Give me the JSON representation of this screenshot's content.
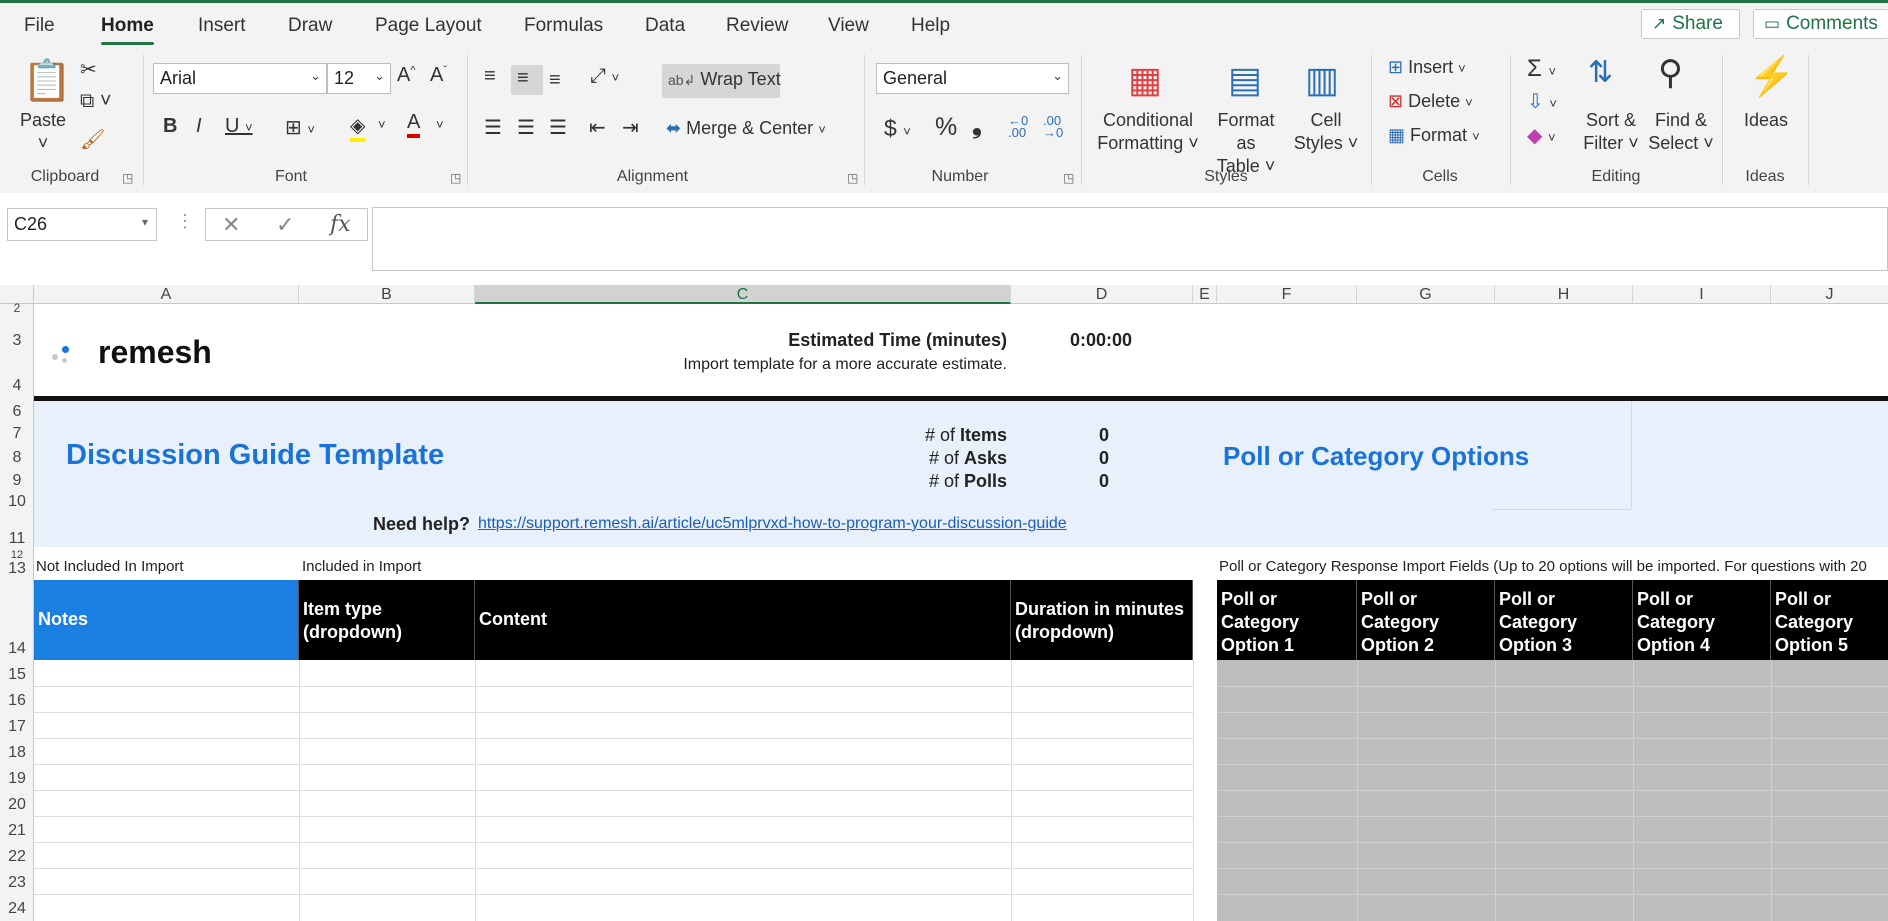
{
  "ribbon_tabs": [
    "File",
    "Home",
    "Insert",
    "Draw",
    "Page Layout",
    "Formulas",
    "Data",
    "Review",
    "View",
    "Help"
  ],
  "share_label": "Share",
  "comments_label": "Comments",
  "clipboard": {
    "paste": "Paste",
    "group": "Clipboard"
  },
  "font": {
    "name": "Arial",
    "size": "12",
    "group": "Font"
  },
  "alignment": {
    "wrap_text": "Wrap Text",
    "merge_center": "Merge & Center",
    "group": "Alignment"
  },
  "number": {
    "format": "General",
    "currency": "$",
    "percent": "%",
    "comma": "❟",
    "inc_decimal": ".00",
    "dec_decimal": ".00",
    "group": "Number"
  },
  "styles": {
    "conditional_1": "Conditional",
    "conditional_2": "Formatting",
    "format_table_1": "Format as",
    "format_table_2": "Table",
    "cell_styles_1": "Cell",
    "cell_styles_2": "Styles",
    "group": "Styles"
  },
  "cells": {
    "insert": "Insert",
    "delete": "Delete",
    "format": "Format",
    "group": "Cells"
  },
  "editing": {
    "sort_1": "Sort &",
    "sort_2": "Filter",
    "find_1": "Find &",
    "find_2": "Select",
    "group": "Editing"
  },
  "ideas": {
    "label": "Ideas",
    "group": "Ideas"
  },
  "name_box": "C26",
  "formula_value": "",
  "columns": [
    "A",
    "B",
    "C",
    "D",
    "E",
    "F",
    "G",
    "H",
    "I",
    "J"
  ],
  "rows": [
    "2",
    "3",
    "4",
    "6",
    "7",
    "8",
    "9",
    "10",
    "11",
    "12",
    "13",
    "14",
    "15",
    "16",
    "17",
    "18",
    "19",
    "20",
    "21",
    "22",
    "23",
    "24"
  ],
  "sheet": {
    "logo": "remesh",
    "est_time_label": "Estimated Time (minutes)",
    "est_time_value": "0:00:00",
    "est_time_note": "Import template for a more accurate estimate.",
    "title": "Discussion Guide Template",
    "items_prefix": "# of ",
    "items_label": "Items",
    "items_value": "0",
    "asks_prefix": "# of ",
    "asks_label": "Asks",
    "asks_value": "0",
    "polls_prefix": "# of ",
    "polls_label": "Polls",
    "polls_value": "0",
    "poll_title": "Poll or Category Options",
    "help_label": "Need help?",
    "help_link": "https://support.remesh.ai/article/uc5mlprvxd-how-to-program-your-discussion-guide",
    "not_included": "Not Included In Import",
    "included": "Included in Import",
    "poll_fields": "Poll or Category Response Import Fields (Up to 20 options will be imported. For questions with 20",
    "headers": {
      "notes": "Notes",
      "item_type": "Item type (dropdown)",
      "content": "Content",
      "duration": "Duration in minutes (dropdown)",
      "opt1": "Poll or Category Option 1",
      "opt2": "Poll or Category Option 2",
      "opt3": "Poll or Category Option 3",
      "opt4": "Poll or Category Option 4",
      "opt5": "Poll or Category Option 5"
    }
  },
  "colors": {
    "accent": "#217346",
    "title_blue": "#1a73d9",
    "band": "#e8f0fb",
    "notes_blue": "#1a7fe0",
    "grey_fill": "#bdbdbd"
  }
}
